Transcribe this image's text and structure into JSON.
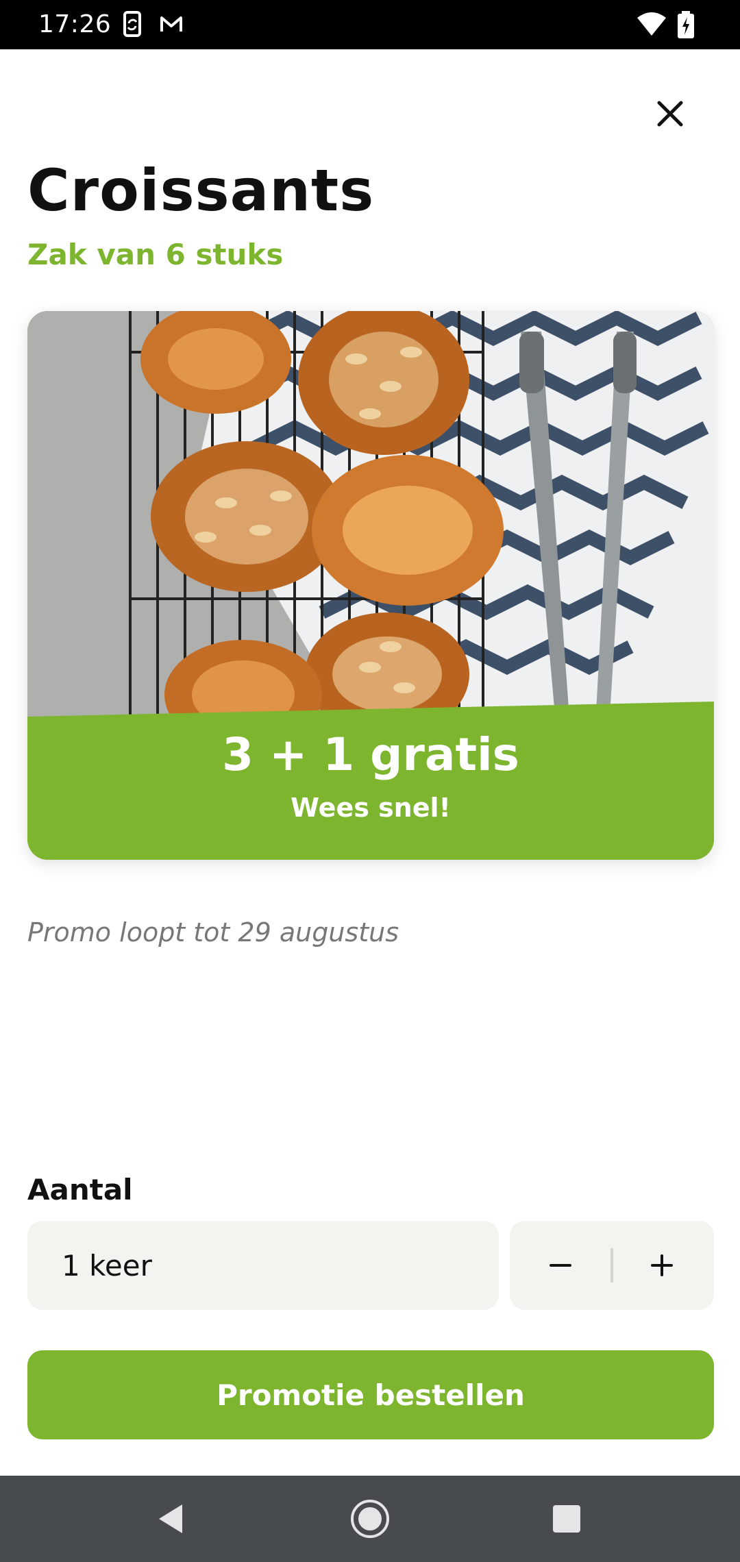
{
  "status_bar": {
    "time": "17:26",
    "icons": [
      "sync-icon",
      "gmail-icon",
      "wifi-icon",
      "battery-charging-icon"
    ]
  },
  "header": {
    "close_icon": "close-icon"
  },
  "product": {
    "title": "Croissants",
    "subtitle": "Zak van 6 stuks"
  },
  "promo": {
    "headline": "3 + 1 gratis",
    "tagline": "Wees snel!",
    "validity": "Promo loopt tot 29 augustus",
    "image_alt": "Croissants on a cooling rack with tongs and napkin"
  },
  "quantity": {
    "label": "Aantal",
    "value": "1 keer",
    "decrement_icon": "minus-icon",
    "increment_icon": "plus-icon"
  },
  "actions": {
    "order_label": "Promotie bestellen"
  },
  "nav_bar": {
    "items": [
      "back-icon",
      "home-icon",
      "recents-icon"
    ]
  },
  "colors": {
    "accent": "#7db52f",
    "field_bg": "#f3f4f0",
    "nav_bg": "#474a4f"
  }
}
